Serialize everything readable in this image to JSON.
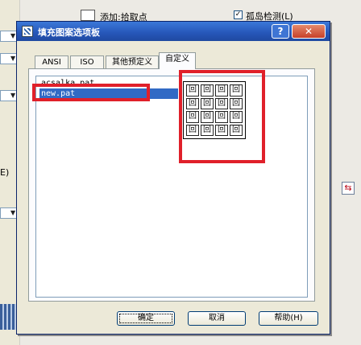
{
  "background": {
    "checkbox_label": "孤岛检测(L)",
    "checkbox_checked": true,
    "add_pick_label": "添加:拾取点",
    "left_text": "E)"
  },
  "dialog": {
    "title": "填充图案选项板",
    "help_glyph": "?",
    "close_glyph": "✕",
    "tabs": [
      "ANSI",
      "ISO",
      "其他预定义",
      "自定义"
    ],
    "active_tab": "自定义",
    "list_items": [
      "acsalka.pat",
      "new.pat"
    ],
    "selected_item": "new.pat",
    "preview_glyph": "回",
    "buttons": {
      "ok": "确定",
      "cancel": "取消",
      "help": "帮助(H)"
    }
  },
  "colors": {
    "highlight": "#e0202a",
    "selection": "#316ac5",
    "titlebar": "#2656b8"
  }
}
